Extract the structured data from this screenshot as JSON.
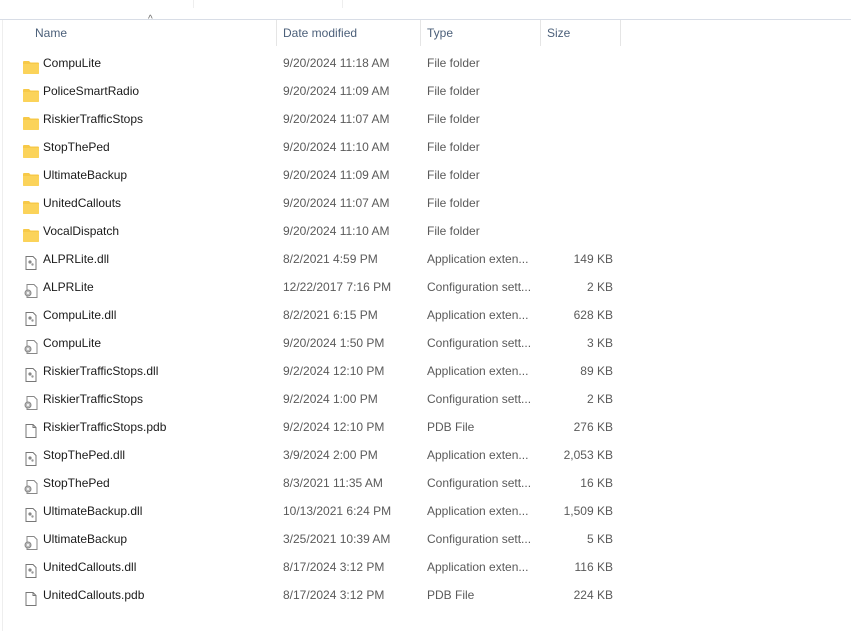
{
  "columns": {
    "name": "Name",
    "date": "Date modified",
    "type": "Type",
    "size": "Size"
  },
  "sort_indicator": "^",
  "files": [
    {
      "name": "CompuLite",
      "date": "9/20/2024 11:18 AM",
      "type": "File folder",
      "size": "",
      "icon": "folder-icon"
    },
    {
      "name": "PoliceSmartRadio",
      "date": "9/20/2024 11:09 AM",
      "type": "File folder",
      "size": "",
      "icon": "folder-icon"
    },
    {
      "name": "RiskierTrafficStops",
      "date": "9/20/2024 11:07 AM",
      "type": "File folder",
      "size": "",
      "icon": "folder-icon"
    },
    {
      "name": "StopThePed",
      "date": "9/20/2024 11:10 AM",
      "type": "File folder",
      "size": "",
      "icon": "folder-icon"
    },
    {
      "name": "UltimateBackup",
      "date": "9/20/2024 11:09 AM",
      "type": "File folder",
      "size": "",
      "icon": "folder-icon"
    },
    {
      "name": "UnitedCallouts",
      "date": "9/20/2024 11:07 AM",
      "type": "File folder",
      "size": "",
      "icon": "folder-icon"
    },
    {
      "name": "VocalDispatch",
      "date": "9/20/2024 11:10 AM",
      "type": "File folder",
      "size": "",
      "icon": "folder-icon"
    },
    {
      "name": "ALPRLite.dll",
      "date": "8/2/2021 4:59 PM",
      "type": "Application exten...",
      "size": "149 KB",
      "icon": "dll-icon"
    },
    {
      "name": "ALPRLite",
      "date": "12/22/2017 7:16 PM",
      "type": "Configuration sett...",
      "size": "2 KB",
      "icon": "config-icon"
    },
    {
      "name": "CompuLite.dll",
      "date": "8/2/2021 6:15 PM",
      "type": "Application exten...",
      "size": "628 KB",
      "icon": "dll-icon"
    },
    {
      "name": "CompuLite",
      "date": "9/20/2024 1:50 PM",
      "type": "Configuration sett...",
      "size": "3 KB",
      "icon": "config-icon"
    },
    {
      "name": "RiskierTrafficStops.dll",
      "date": "9/2/2024 12:10 PM",
      "type": "Application exten...",
      "size": "89 KB",
      "icon": "dll-icon"
    },
    {
      "name": "RiskierTrafficStops",
      "date": "9/2/2024 1:00 PM",
      "type": "Configuration sett...",
      "size": "2 KB",
      "icon": "config-icon"
    },
    {
      "name": "RiskierTrafficStops.pdb",
      "date": "9/2/2024 12:10 PM",
      "type": "PDB File",
      "size": "276 KB",
      "icon": "file-icon"
    },
    {
      "name": "StopThePed.dll",
      "date": "3/9/2024 2:00 PM",
      "type": "Application exten...",
      "size": "2,053 KB",
      "icon": "dll-icon"
    },
    {
      "name": "StopThePed",
      "date": "8/3/2021 11:35 AM",
      "type": "Configuration sett...",
      "size": "16 KB",
      "icon": "config-icon"
    },
    {
      "name": "UltimateBackup.dll",
      "date": "10/13/2021 6:24 PM",
      "type": "Application exten...",
      "size": "1,509 KB",
      "icon": "dll-icon"
    },
    {
      "name": "UltimateBackup",
      "date": "3/25/2021 10:39 AM",
      "type": "Configuration sett...",
      "size": "5 KB",
      "icon": "config-icon"
    },
    {
      "name": "UnitedCallouts.dll",
      "date": "8/17/2024 3:12 PM",
      "type": "Application exten...",
      "size": "116 KB",
      "icon": "dll-icon"
    },
    {
      "name": "UnitedCallouts.pdb",
      "date": "8/17/2024 3:12 PM",
      "type": "PDB File",
      "size": "224 KB",
      "icon": "file-icon"
    }
  ],
  "colors": {
    "folder": "#f7c948",
    "header_text": "#4c607a"
  }
}
